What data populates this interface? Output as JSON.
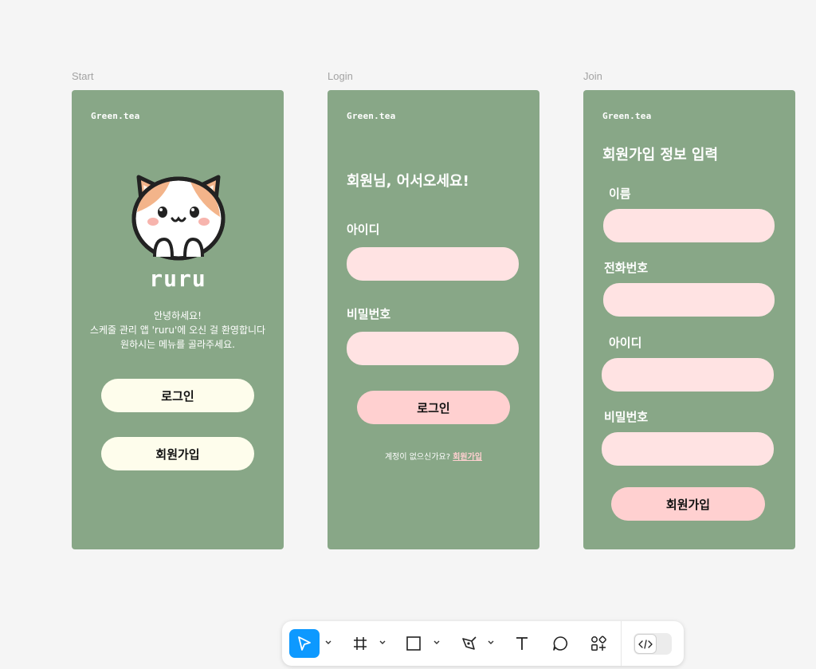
{
  "frames": {
    "start": {
      "label": "Start",
      "brand": "Green.tea",
      "app_name": "ruru",
      "greeting_lines": [
        "안녕하세요!",
        "스케줄 관리 앱 'ruru'에 오신 걸 환영합니다",
        "원하시는 메뉴를 골라주세요."
      ],
      "login_button": "로그인",
      "join_button": "회원가입"
    },
    "login": {
      "label": "Login",
      "brand": "Green.tea",
      "heading": "회원님, 어서오세요!",
      "id_label": "아이디",
      "pw_label": "비밀번호",
      "login_button": "로그인",
      "no_account": "계정이 없으신가요?",
      "join_link": "회원가입"
    },
    "join": {
      "label": "Join",
      "brand": "Green.tea",
      "heading": "회원가입 정보 입력",
      "name_label": "이름",
      "phone_label": "전화번호",
      "id_label": "아이디",
      "pw_label": "비밀번호",
      "join_button": "회원가입"
    }
  },
  "toolbar": {
    "tools": [
      "move-tool",
      "frame-tool",
      "rectangle-tool",
      "pen-tool",
      "text-tool",
      "comment-tool",
      "assets-tool",
      "dev-mode-toggle"
    ],
    "active_tool": "move-tool"
  },
  "colors": {
    "canvas": "#f5f5f5",
    "frame_green": "#88a787",
    "cream_button": "#fefdec",
    "pink_button": "#ffd0d0",
    "pink_field": "#ffe3e3",
    "active_tool": "#0d99ff"
  }
}
